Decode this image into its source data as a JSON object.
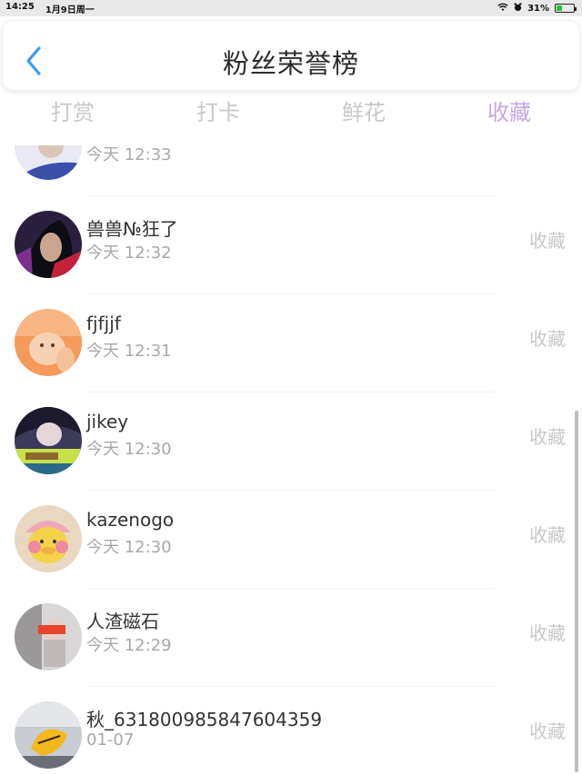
{
  "status_bar": {
    "time": "14:25",
    "date": "1月9日周一",
    "battery": "31%",
    "battery_level": 0.31
  },
  "header": {
    "title": "粉丝荣誉榜"
  },
  "tabs": [
    {
      "label": "打赏",
      "active": false
    },
    {
      "label": "打卡",
      "active": false
    },
    {
      "label": "鲜花",
      "active": false
    },
    {
      "label": "收藏",
      "active": true
    }
  ],
  "colors": {
    "accent": "#c7a5e8",
    "back_arrow": "#3a9af5",
    "muted": "#c8c8c8"
  },
  "rows": [
    {
      "name": "",
      "time": "今天 12:33",
      "action": ""
    },
    {
      "name": "兽兽№狂了",
      "time": "今天 12:32",
      "action": "收藏"
    },
    {
      "name": "fjfjjf",
      "time": "今天 12:31",
      "action": "收藏"
    },
    {
      "name": "jikey",
      "time": "今天 12:30",
      "action": "收藏"
    },
    {
      "name": "kazenogo",
      "time": "今天 12:30",
      "action": "收藏"
    },
    {
      "name": "人渣磁石",
      "time": "今天 12:29",
      "action": "收藏"
    },
    {
      "name": "秋_631800985847604359",
      "time": "01-07",
      "action": "收藏"
    }
  ]
}
